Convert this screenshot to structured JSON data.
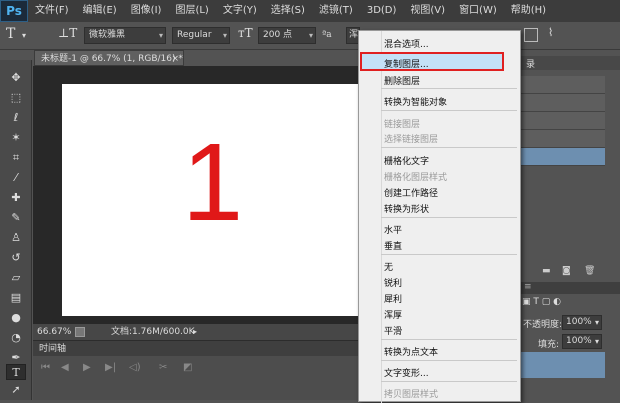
{
  "app": {
    "logo": "Ps"
  },
  "menubar": [
    "文件(F)",
    "编辑(E)",
    "图像(I)",
    "图层(L)",
    "文字(Y)",
    "选择(S)",
    "滤镜(T)",
    "3D(D)",
    "视图(V)",
    "窗口(W)",
    "帮助(H)"
  ],
  "options": {
    "font_family": "微软雅黑",
    "font_style": "Regular",
    "font_size": "200 点",
    "aa_label": "a",
    "partial": "浑"
  },
  "document": {
    "tab_title": "未标题-1 @ 66.7% (1, RGB/16) *",
    "tab_close": "×",
    "content_text": "1",
    "zoom": "66.67%",
    "doc_info": "文档:1.76M/600.0K"
  },
  "timeline": {
    "title": "时间轴"
  },
  "context_menu": {
    "items": [
      {
        "label": "混合选项...",
        "enabled": true
      },
      {
        "label": "复制图层...",
        "enabled": true,
        "highlighted": true
      },
      {
        "label": "删除图层",
        "enabled": true
      },
      {
        "label": "转换为智能对象",
        "enabled": true
      },
      {
        "label": "链接图层",
        "enabled": false
      },
      {
        "label": "选择链接图层",
        "enabled": false
      },
      {
        "label": "栅格化文字",
        "enabled": true
      },
      {
        "label": "栅格化图层样式",
        "enabled": false
      },
      {
        "label": "创建工作路径",
        "enabled": true
      },
      {
        "label": "转换为形状",
        "enabled": true
      },
      {
        "label": "水平",
        "enabled": true
      },
      {
        "label": "垂直",
        "enabled": true
      },
      {
        "label": "无",
        "enabled": true
      },
      {
        "label": "锐利",
        "enabled": true
      },
      {
        "label": "犀利",
        "enabled": true
      },
      {
        "label": "浑厚",
        "enabled": true
      },
      {
        "label": "平滑",
        "enabled": true
      },
      {
        "label": "转换为点文本",
        "enabled": true
      },
      {
        "label": "文字变形...",
        "enabled": true
      },
      {
        "label": "拷贝图层样式",
        "enabled": false
      }
    ]
  },
  "layers_panel": {
    "tab_partial": "录",
    "opacity_label": "不透明度:",
    "opacity_value": "100%",
    "fill_label": "填充:",
    "fill_value": "100%"
  },
  "colors": {
    "accent_red": "#e01818",
    "highlight": "#c4e1f6"
  }
}
